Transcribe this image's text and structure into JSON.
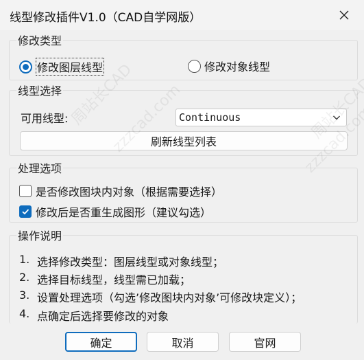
{
  "window": {
    "title": "线型修改插件V1.0（CAD自学网版）"
  },
  "modify_type": {
    "title": "修改类型",
    "options": [
      {
        "label": "修改图层线型",
        "checked": true
      },
      {
        "label": "修改对象线型",
        "checked": false
      }
    ]
  },
  "linetype": {
    "title": "线型选择",
    "available_label": "可用线型:",
    "selected": "Continuous",
    "refresh_label": "刷新线型列表"
  },
  "processing": {
    "title": "处理选项",
    "options": [
      {
        "label": "是否修改图块内对象（根据需要选择）",
        "checked": false
      },
      {
        "label": "修改后是否重生成图形（建议勾选）",
        "checked": true
      }
    ]
  },
  "instructions": {
    "title": "操作说明",
    "steps": [
      {
        "num": "1.",
        "text": "选择修改类型：图层线型或对象线型；"
      },
      {
        "num": "2.",
        "text": "选择目标线型，线型需已加载；"
      },
      {
        "num": "3.",
        "text": "设置处理选项（勾选’修改图块内对象’可修改块定义）；"
      },
      {
        "num": "4.",
        "text": "点确定后选择要修改的对象"
      }
    ]
  },
  "buttons": {
    "ok": "确定",
    "cancel": "取消",
    "website": "官网"
  },
  "watermark": [
    "zzzcad.com",
    "周站长CAD"
  ],
  "colors": {
    "accent": "#0f6cbd",
    "background": "#f0f0f0"
  }
}
